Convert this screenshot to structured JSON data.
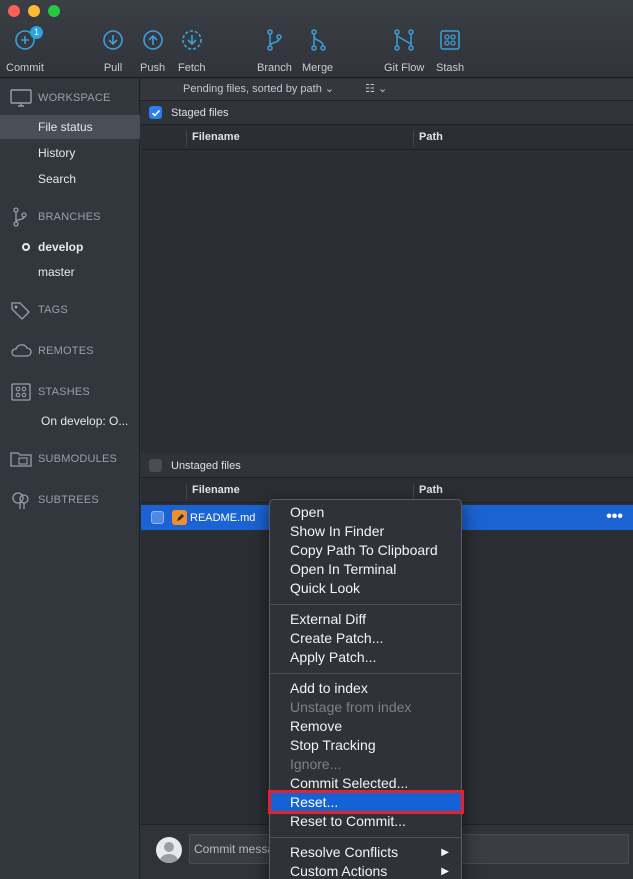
{
  "toolbar": {
    "commit": {
      "label": "Commit",
      "badge": "1"
    },
    "pull": "Pull",
    "push": "Push",
    "fetch": "Fetch",
    "branch": "Branch",
    "merge": "Merge",
    "gitflow": "Git Flow",
    "stash": "Stash"
  },
  "sidebar": {
    "workspace": {
      "title": "WORKSPACE",
      "items": [
        "File status",
        "History",
        "Search"
      ],
      "selected": "File status"
    },
    "branches": {
      "title": "BRANCHES",
      "items": [
        "develop",
        "master"
      ],
      "current": "develop"
    },
    "tags": "TAGS",
    "remotes": "REMOTES",
    "stashes": {
      "title": "STASHES",
      "items": [
        "On develop: O..."
      ]
    },
    "submodules": "SUBMODULES",
    "subtrees": "SUBTREES"
  },
  "subbar": {
    "sort_label": "Pending files, sorted by path",
    "view_icon": "list-view-icon"
  },
  "staged": {
    "title": "Staged files",
    "checked": true,
    "columns": [
      "Filename",
      "Path"
    ]
  },
  "unstaged": {
    "title": "Unstaged files",
    "checked": false,
    "columns": [
      "Filename",
      "Path"
    ],
    "files": [
      {
        "name": "README.md",
        "icon": "pencil-icon",
        "status_color": "#f0902c"
      }
    ]
  },
  "commit": {
    "placeholder": "Commit message"
  },
  "context_menu": {
    "groups": [
      [
        {
          "label": "Open",
          "enabled": true
        },
        {
          "label": "Show In Finder",
          "enabled": true
        },
        {
          "label": "Copy Path To Clipboard",
          "enabled": true
        },
        {
          "label": "Open In Terminal",
          "enabled": true
        },
        {
          "label": "Quick Look",
          "enabled": true
        }
      ],
      [
        {
          "label": "External Diff",
          "enabled": true
        },
        {
          "label": "Create Patch...",
          "enabled": true
        },
        {
          "label": "Apply Patch...",
          "enabled": true
        }
      ],
      [
        {
          "label": "Add to index",
          "enabled": true
        },
        {
          "label": "Unstage from index",
          "enabled": false
        },
        {
          "label": "Remove",
          "enabled": true
        },
        {
          "label": "Stop Tracking",
          "enabled": true
        },
        {
          "label": "Ignore...",
          "enabled": false
        },
        {
          "label": "Commit Selected...",
          "enabled": true
        },
        {
          "label": "Reset...",
          "enabled": true,
          "highlighted": true
        },
        {
          "label": "Reset to Commit...",
          "enabled": true
        }
      ],
      [
        {
          "label": "Resolve Conflicts",
          "enabled": true,
          "submenu": true
        },
        {
          "label": "Custom Actions",
          "enabled": true,
          "submenu": true
        }
      ]
    ]
  },
  "colors": {
    "accent": "#1463d6",
    "selection_row": "#1b63d2",
    "annotation_box": "#e2232a",
    "icon_blue": "#3aa0dc"
  }
}
